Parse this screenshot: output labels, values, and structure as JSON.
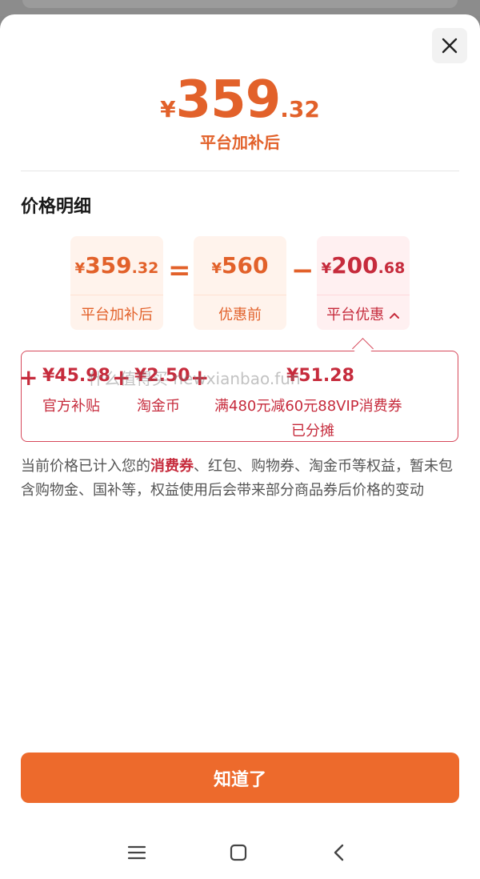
{
  "header": {
    "price": {
      "currency": "¥",
      "integer": "359",
      "decimal": ".32"
    },
    "subtitle": "平台加补后"
  },
  "detail": {
    "title": "价格明细",
    "boxes": [
      {
        "currency": "¥",
        "integer": "359",
        "decimal": ".32",
        "label": "平台加补后"
      },
      {
        "currency": "¥",
        "integer": "560",
        "decimal": "",
        "label": "优惠前"
      },
      {
        "currency": "¥",
        "integer": "200",
        "decimal": ".68",
        "label": "平台优惠",
        "chevron": "chevron-up-icon"
      }
    ],
    "operators": [
      "=",
      "−"
    ],
    "breakdown": {
      "items": [
        {
          "value": "¥45.98",
          "label": "官方补贴"
        },
        {
          "value": "¥2.50",
          "label": "淘金币"
        },
        {
          "value": "¥51.28",
          "label": "满480元减60元88VIP消费券",
          "label2": "已分摊"
        }
      ],
      "plus": "+",
      "watermark": "什么值得买 newxianbao.fun"
    }
  },
  "note": {
    "before": "当前价格已计入您的",
    "highlight": "消费券",
    "after": "、红包、购物券、淘金币等权益，暂未包含购物金、国补等，权益使用后会带来部分商品券后价格的变动"
  },
  "button": {
    "label": "知道了"
  },
  "colors": {
    "accent": "#e2612a",
    "button": "#ed6a2c",
    "discount_red": "#c62b3c"
  },
  "navbar": {
    "icons": [
      "menu-icon",
      "home-square-icon",
      "back-chevron-icon"
    ]
  }
}
